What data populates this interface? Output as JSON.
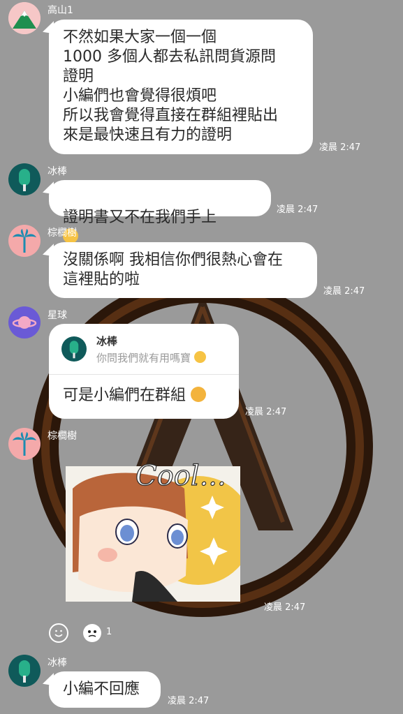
{
  "messages": [
    {
      "sender": "高山1",
      "text": "不然如果大家一個一個\n1000 多個人都去私訊問貨源問\n證明\n小編們也會覺得很煩吧\n所以我會覺得直接在群組裡貼出\n來是最快速且有力的證明",
      "time": "凌晨 2:47"
    },
    {
      "sender": "冰棒",
      "text": "證明書又不在我們手上",
      "time": "凌晨 2:47"
    },
    {
      "sender": "棕櫚樹",
      "text": "沒關係啊 我相信你們很熱心會在\n這裡貼的啦",
      "time": "凌晨 2:47"
    },
    {
      "sender": "星球",
      "reply_to": {
        "sender": "冰棒",
        "text": "你問我們就有用嗎寶"
      },
      "text": "可是小編們在群組",
      "time": "凌晨 2:47"
    },
    {
      "sender": "棕櫚樹",
      "sticker_text": "Cool...",
      "time": "凌晨 2:47"
    },
    {
      "sender": "冰棒",
      "text": "小編不回應",
      "time": "凌晨 2:47"
    }
  ],
  "reactions": {
    "count": "1"
  },
  "colors": {
    "background": "#9a9a9a",
    "bubble": "#ffffff",
    "avatar_mountain": "#f8c9c9",
    "avatar_popsicle": "#0f5a5a",
    "avatar_palm": "#f4a9aa",
    "avatar_planet": "#6a5ad6"
  }
}
